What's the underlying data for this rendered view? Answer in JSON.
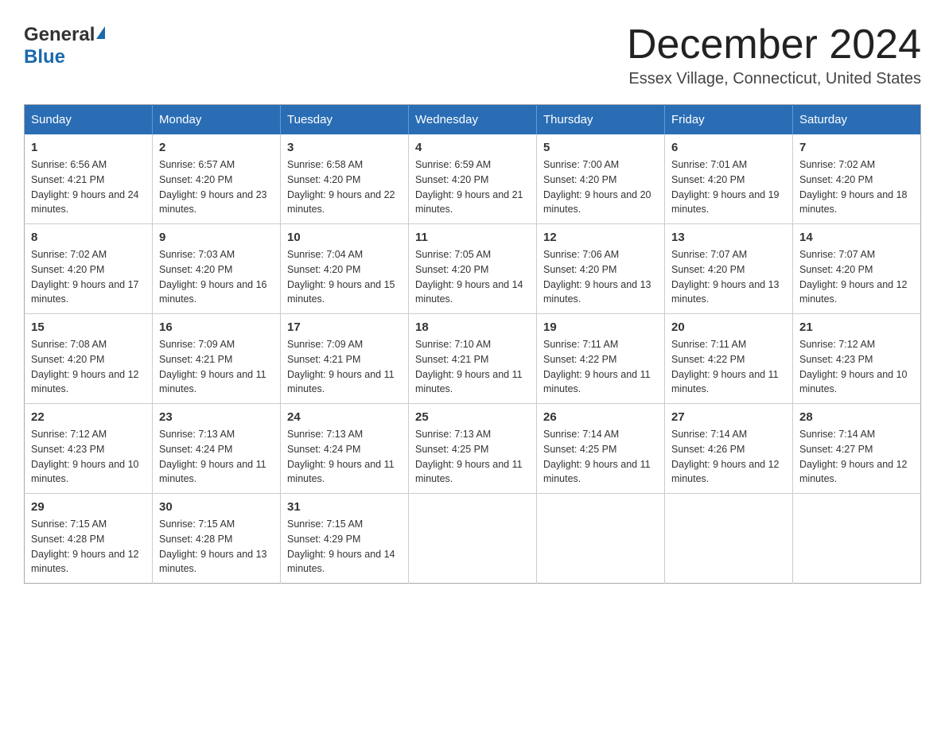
{
  "header": {
    "logo_general": "General",
    "logo_blue": "Blue",
    "month_title": "December 2024",
    "location": "Essex Village, Connecticut, United States"
  },
  "days_of_week": [
    "Sunday",
    "Monday",
    "Tuesday",
    "Wednesday",
    "Thursday",
    "Friday",
    "Saturday"
  ],
  "weeks": [
    [
      {
        "day": "1",
        "sunrise": "6:56 AM",
        "sunset": "4:21 PM",
        "daylight": "9 hours and 24 minutes."
      },
      {
        "day": "2",
        "sunrise": "6:57 AM",
        "sunset": "4:20 PM",
        "daylight": "9 hours and 23 minutes."
      },
      {
        "day": "3",
        "sunrise": "6:58 AM",
        "sunset": "4:20 PM",
        "daylight": "9 hours and 22 minutes."
      },
      {
        "day": "4",
        "sunrise": "6:59 AM",
        "sunset": "4:20 PM",
        "daylight": "9 hours and 21 minutes."
      },
      {
        "day": "5",
        "sunrise": "7:00 AM",
        "sunset": "4:20 PM",
        "daylight": "9 hours and 20 minutes."
      },
      {
        "day": "6",
        "sunrise": "7:01 AM",
        "sunset": "4:20 PM",
        "daylight": "9 hours and 19 minutes."
      },
      {
        "day": "7",
        "sunrise": "7:02 AM",
        "sunset": "4:20 PM",
        "daylight": "9 hours and 18 minutes."
      }
    ],
    [
      {
        "day": "8",
        "sunrise": "7:02 AM",
        "sunset": "4:20 PM",
        "daylight": "9 hours and 17 minutes."
      },
      {
        "day": "9",
        "sunrise": "7:03 AM",
        "sunset": "4:20 PM",
        "daylight": "9 hours and 16 minutes."
      },
      {
        "day": "10",
        "sunrise": "7:04 AM",
        "sunset": "4:20 PM",
        "daylight": "9 hours and 15 minutes."
      },
      {
        "day": "11",
        "sunrise": "7:05 AM",
        "sunset": "4:20 PM",
        "daylight": "9 hours and 14 minutes."
      },
      {
        "day": "12",
        "sunrise": "7:06 AM",
        "sunset": "4:20 PM",
        "daylight": "9 hours and 13 minutes."
      },
      {
        "day": "13",
        "sunrise": "7:07 AM",
        "sunset": "4:20 PM",
        "daylight": "9 hours and 13 minutes."
      },
      {
        "day": "14",
        "sunrise": "7:07 AM",
        "sunset": "4:20 PM",
        "daylight": "9 hours and 12 minutes."
      }
    ],
    [
      {
        "day": "15",
        "sunrise": "7:08 AM",
        "sunset": "4:20 PM",
        "daylight": "9 hours and 12 minutes."
      },
      {
        "day": "16",
        "sunrise": "7:09 AM",
        "sunset": "4:21 PM",
        "daylight": "9 hours and 11 minutes."
      },
      {
        "day": "17",
        "sunrise": "7:09 AM",
        "sunset": "4:21 PM",
        "daylight": "9 hours and 11 minutes."
      },
      {
        "day": "18",
        "sunrise": "7:10 AM",
        "sunset": "4:21 PM",
        "daylight": "9 hours and 11 minutes."
      },
      {
        "day": "19",
        "sunrise": "7:11 AM",
        "sunset": "4:22 PM",
        "daylight": "9 hours and 11 minutes."
      },
      {
        "day": "20",
        "sunrise": "7:11 AM",
        "sunset": "4:22 PM",
        "daylight": "9 hours and 11 minutes."
      },
      {
        "day": "21",
        "sunrise": "7:12 AM",
        "sunset": "4:23 PM",
        "daylight": "9 hours and 10 minutes."
      }
    ],
    [
      {
        "day": "22",
        "sunrise": "7:12 AM",
        "sunset": "4:23 PM",
        "daylight": "9 hours and 10 minutes."
      },
      {
        "day": "23",
        "sunrise": "7:13 AM",
        "sunset": "4:24 PM",
        "daylight": "9 hours and 11 minutes."
      },
      {
        "day": "24",
        "sunrise": "7:13 AM",
        "sunset": "4:24 PM",
        "daylight": "9 hours and 11 minutes."
      },
      {
        "day": "25",
        "sunrise": "7:13 AM",
        "sunset": "4:25 PM",
        "daylight": "9 hours and 11 minutes."
      },
      {
        "day": "26",
        "sunrise": "7:14 AM",
        "sunset": "4:25 PM",
        "daylight": "9 hours and 11 minutes."
      },
      {
        "day": "27",
        "sunrise": "7:14 AM",
        "sunset": "4:26 PM",
        "daylight": "9 hours and 12 minutes."
      },
      {
        "day": "28",
        "sunrise": "7:14 AM",
        "sunset": "4:27 PM",
        "daylight": "9 hours and 12 minutes."
      }
    ],
    [
      {
        "day": "29",
        "sunrise": "7:15 AM",
        "sunset": "4:28 PM",
        "daylight": "9 hours and 12 minutes."
      },
      {
        "day": "30",
        "sunrise": "7:15 AM",
        "sunset": "4:28 PM",
        "daylight": "9 hours and 13 minutes."
      },
      {
        "day": "31",
        "sunrise": "7:15 AM",
        "sunset": "4:29 PM",
        "daylight": "9 hours and 14 minutes."
      },
      null,
      null,
      null,
      null
    ]
  ]
}
